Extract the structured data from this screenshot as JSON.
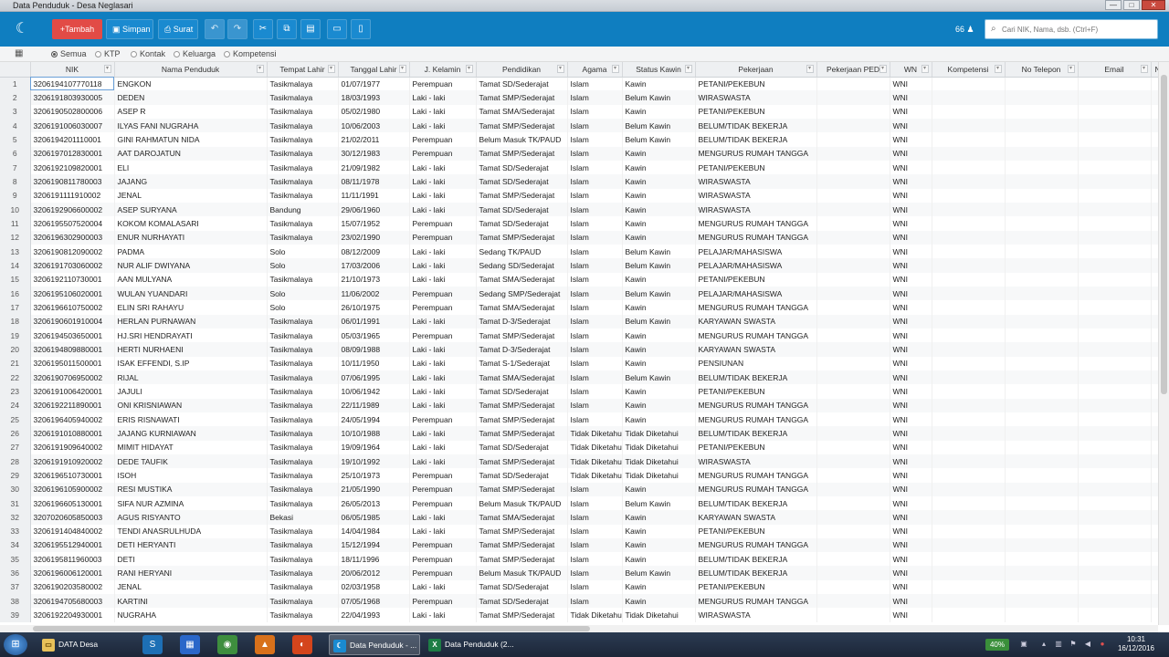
{
  "window": {
    "title": "Data Penduduk - Desa Neglasari",
    "min": "—",
    "max": "□",
    "close": "✕"
  },
  "toolbar": {
    "logo": "☾",
    "add_label": "+Tambah",
    "save_label": "Simpan",
    "letter_label": "Surat",
    "count": "66",
    "search_placeholder": "Cari NIK, Nama, dsb. (Ctrl+F)"
  },
  "filters": [
    "Semua",
    "KTP",
    "Kontak",
    "Keluarga",
    "Kompetensi"
  ],
  "table": {
    "columns": [
      "NIK",
      "Nama Penduduk",
      "Tempat Lahir",
      "Tanggal Lahir",
      "J. Kelamin",
      "Pendidikan",
      "Agama",
      "Status Kawin",
      "Pekerjaan",
      "Pekerjaan PED",
      "WN",
      "Kompetensi",
      "No Telepon",
      "Email",
      "No K"
    ],
    "rows": [
      [
        "3206194107770118",
        "ENGKON",
        "Tasikmalaya",
        "01/07/1977",
        "Perempuan",
        "Tamat SD/Sederajat",
        "Islam",
        "Kawin",
        "PETANI/PEKEBUN",
        "",
        "WNI"
      ],
      [
        "3206191803930005",
        "DEDEN",
        "Tasikmalaya",
        "18/03/1993",
        "Laki - laki",
        "Tamat SMP/Sederajat",
        "Islam",
        "Belum Kawin",
        "WIRASWASTA",
        "",
        "WNI"
      ],
      [
        "3206190502800006",
        "ASEP R",
        "Tasikmalaya",
        "05/02/1980",
        "Laki - laki",
        "Tamat SMA/Sederajat",
        "Islam",
        "Kawin",
        "PETANI/PEKEBUN",
        "",
        "WNI"
      ],
      [
        "3206191006030007",
        "ILYAS FANI NUGRAHA",
        "Tasikmalaya",
        "10/06/2003",
        "Laki - laki",
        "Tamat SMP/Sederajat",
        "Islam",
        "Belum Kawin",
        "BELUM/TIDAK BEKERJA",
        "",
        "WNI"
      ],
      [
        "3206194201110001",
        "GINI RAHMATUN NIDA",
        "Tasikmalaya",
        "21/02/2011",
        "Perempuan",
        "Belum Masuk TK/PAUD",
        "Islam",
        "Belum Kawin",
        "BELUM/TIDAK BEKERJA",
        "",
        "WNI"
      ],
      [
        "3206197012830001",
        "AAT DAROJATUN",
        "Tasikmalaya",
        "30/12/1983",
        "Perempuan",
        "Tamat SMP/Sederajat",
        "Islam",
        "Kawin",
        "MENGURUS RUMAH TANGGA",
        "",
        "WNI"
      ],
      [
        "3206192109820001",
        "ELI",
        "Tasikmalaya",
        "21/09/1982",
        "Laki - laki",
        "Tamat SD/Sederajat",
        "Islam",
        "Kawin",
        "PETANI/PEKEBUN",
        "",
        "WNI"
      ],
      [
        "3206190811780003",
        "JAJANG",
        "Tasikmalaya",
        "08/11/1978",
        "Laki - laki",
        "Tamat SD/Sederajat",
        "Islam",
        "Kawin",
        "WIRASWASTA",
        "",
        "WNI"
      ],
      [
        "3206191111910002",
        "JENAL",
        "Tasikmalaya",
        "11/11/1991",
        "Laki - laki",
        "Tamat SMP/Sederajat",
        "Islam",
        "Kawin",
        "WIRASWASTA",
        "",
        "WNI"
      ],
      [
        "3206192906600002",
        "ASEP SURYANA",
        "Bandung",
        "29/06/1960",
        "Laki - laki",
        "Tamat SD/Sederajat",
        "Islam",
        "Kawin",
        "WIRASWASTA",
        "",
        "WNI"
      ],
      [
        "3206195507520004",
        "KOKOM KOMALASARI",
        "Tasikmalaya",
        "15/07/1952",
        "Perempuan",
        "Tamat SD/Sederajat",
        "Islam",
        "Kawin",
        "MENGURUS RUMAH TANGGA",
        "",
        "WNI"
      ],
      [
        "3206196302900003",
        "ENUR NURHAYATI",
        "Tasikmalaya",
        "23/02/1990",
        "Perempuan",
        "Tamat SMP/Sederajat",
        "Islam",
        "Kawin",
        "MENGURUS RUMAH TANGGA",
        "",
        "WNI"
      ],
      [
        "3206190812090002",
        "PADMA",
        "Solo",
        "08/12/2009",
        "Laki - laki",
        "Sedang TK/PAUD",
        "Islam",
        "Belum Kawin",
        "PELAJAR/MAHASISWA",
        "",
        "WNI"
      ],
      [
        "3206191703060002",
        "NUR ALIF DWIYANA",
        "Solo",
        "17/03/2006",
        "Laki - laki",
        "Sedang SD/Sederajat",
        "Islam",
        "Belum Kawin",
        "PELAJAR/MAHASISWA",
        "",
        "WNI"
      ],
      [
        "3206192110730001",
        "AAN MULYANA",
        "Tasikmalaya",
        "21/10/1973",
        "Laki - laki",
        "Tamat SMA/Sederajat",
        "Islam",
        "Kawin",
        "PETANI/PEKEBUN",
        "",
        "WNI"
      ],
      [
        "3206195106020001",
        "WULAN YUANDARI",
        "Solo",
        "11/06/2002",
        "Perempuan",
        "Sedang SMP/Sederajat",
        "Islam",
        "Belum Kawin",
        "PELAJAR/MAHASISWA",
        "",
        "WNI"
      ],
      [
        "3206196610750002",
        "ELIN SRI RAHAYU",
        "Solo",
        "26/10/1975",
        "Perempuan",
        "Tamat SMA/Sederajat",
        "Islam",
        "Kawin",
        "MENGURUS RUMAH TANGGA",
        "",
        "WNI"
      ],
      [
        "3206190601910004",
        "HERLAN PURNAWAN",
        "Tasikmalaya",
        "06/01/1991",
        "Laki - laki",
        "Tamat D-3/Sederajat",
        "Islam",
        "Belum Kawin",
        "KARYAWAN SWASTA",
        "",
        "WNI"
      ],
      [
        "3206194503650001",
        "HJ.SRI HENDRAYATI",
        "Tasikmalaya",
        "05/03/1965",
        "Perempuan",
        "Tamat SMP/Sederajat",
        "Islam",
        "Kawin",
        "MENGURUS RUMAH TANGGA",
        "",
        "WNI"
      ],
      [
        "3206194809880001",
        "HERTI NURHAENI",
        "Tasikmalaya",
        "08/09/1988",
        "Laki - laki",
        "Tamat D-3/Sederajat",
        "Islam",
        "Kawin",
        "KARYAWAN SWASTA",
        "",
        "WNI"
      ],
      [
        "3206195011500001",
        "ISAK EFFENDI, S.IP",
        "Tasikmalaya",
        "10/11/1950",
        "Laki - laki",
        "Tamat S-1/Sederajat",
        "Islam",
        "Kawin",
        "PENSIUNAN",
        "",
        "WNI"
      ],
      [
        "3206190706950002",
        "RIJAL",
        "Tasikmalaya",
        "07/06/1995",
        "Laki - laki",
        "Tamat SMA/Sederajat",
        "Islam",
        "Belum Kawin",
        "BELUM/TIDAK BEKERJA",
        "",
        "WNI"
      ],
      [
        "3206191006420001",
        "JAJULI",
        "Tasikmalaya",
        "10/06/1942",
        "Laki - laki",
        "Tamat SD/Sederajat",
        "Islam",
        "Kawin",
        "PETANI/PEKEBUN",
        "",
        "WNI"
      ],
      [
        "3206192211890001",
        "ONI KRISNIAWAN",
        "Tasikmalaya",
        "22/11/1989",
        "Laki - laki",
        "Tamat SMP/Sederajat",
        "Islam",
        "Kawin",
        "MENGURUS RUMAH TANGGA",
        "",
        "WNI"
      ],
      [
        "3206196405940002",
        "ERIS RISNAWATI",
        "Tasikmalaya",
        "24/05/1994",
        "Perempuan",
        "Tamat SMP/Sederajat",
        "Islam",
        "Kawin",
        "MENGURUS RUMAH TANGGA",
        "",
        "WNI"
      ],
      [
        "3206191010880001",
        "JAJANG KURNIAWAN",
        "Tasikmalaya",
        "10/10/1988",
        "Laki - laki",
        "Tamat SMP/Sederajat",
        "Tidak Diketahui",
        "Tidak Diketahui",
        "BELUM/TIDAK BEKERJA",
        "",
        "WNI"
      ],
      [
        "3206191909640002",
        "MIMIT HIDAYAT",
        "Tasikmalaya",
        "19/09/1964",
        "Laki - laki",
        "Tamat SD/Sederajat",
        "Tidak Diketahui",
        "Tidak Diketahui",
        "PETANI/PEKEBUN",
        "",
        "WNI"
      ],
      [
        "3206191910920002",
        "DEDE TAUFIK",
        "Tasikmalaya",
        "19/10/1992",
        "Laki - laki",
        "Tamat SMP/Sederajat",
        "Tidak Diketahui",
        "Tidak Diketahui",
        "WIRASWASTA",
        "",
        "WNI"
      ],
      [
        "3206196510730001",
        "ISOH",
        "Tasikmalaya",
        "25/10/1973",
        "Perempuan",
        "Tamat SD/Sederajat",
        "Tidak Diketahui",
        "Tidak Diketahui",
        "MENGURUS RUMAH TANGGA",
        "",
        "WNI"
      ],
      [
        "3206196105900002",
        "RESI MUSTIKA",
        "Tasikmalaya",
        "21/05/1990",
        "Perempuan",
        "Tamat SMP/Sederajat",
        "Islam",
        "Kawin",
        "MENGURUS RUMAH TANGGA",
        "",
        "WNI"
      ],
      [
        "3206196605130001",
        "SIFA NUR AZMINA",
        "Tasikmalaya",
        "26/05/2013",
        "Perempuan",
        "Belum Masuk TK/PAUD",
        "Islam",
        "Belum Kawin",
        "BELUM/TIDAK BEKERJA",
        "",
        "WNI"
      ],
      [
        "3207020605850003",
        "AGUS RISYANTO",
        "Bekasi",
        "06/05/1985",
        "Laki - laki",
        "Tamat SMA/Sederajat",
        "Islam",
        "Kawin",
        "KARYAWAN SWASTA",
        "",
        "WNI"
      ],
      [
        "3206191404840002",
        "TENDI ANASRULHUDA",
        "Tasikmalaya",
        "14/04/1984",
        "Laki - laki",
        "Tamat SMP/Sederajat",
        "Islam",
        "Kawin",
        "PETANI/PEKEBUN",
        "",
        "WNI"
      ],
      [
        "3206195512940001",
        "DETI HERYANTI",
        "Tasikmalaya",
        "15/12/1994",
        "Perempuan",
        "Tamat SMP/Sederajat",
        "Islam",
        "Kawin",
        "MENGURUS RUMAH TANGGA",
        "",
        "WNI"
      ],
      [
        "3206195811960003",
        "DETI",
        "Tasikmalaya",
        "18/11/1996",
        "Perempuan",
        "Tamat SMP/Sederajat",
        "Islam",
        "Kawin",
        "BELUM/TIDAK BEKERJA",
        "",
        "WNI"
      ],
      [
        "3206196006120001",
        "RANI HERYANI",
        "Tasikmalaya",
        "20/06/2012",
        "Perempuan",
        "Belum Masuk TK/PAUD",
        "Islam",
        "Belum Kawin",
        "BELUM/TIDAK BEKERJA",
        "",
        "WNI"
      ],
      [
        "3206190203580002",
        "JENAL",
        "Tasikmalaya",
        "02/03/1958",
        "Laki - laki",
        "Tamat SD/Sederajat",
        "Islam",
        "Kawin",
        "PETANI/PEKEBUN",
        "",
        "WNI"
      ],
      [
        "3206194705680003",
        "KARTINI",
        "Tasikmalaya",
        "07/05/1968",
        "Perempuan",
        "Tamat SD/Sederajat",
        "Islam",
        "Kawin",
        "MENGURUS RUMAH TANGGA",
        "",
        "WNI"
      ],
      [
        "3206192204930001",
        "NUGRAHA",
        "Tasikmalaya",
        "22/04/1993",
        "Laki - laki",
        "Tamat SMP/Sederajat",
        "Tidak Diketahui",
        "Tidak Diketahui",
        "WIRASWASTA",
        "",
        "WNI"
      ]
    ]
  },
  "taskbar": {
    "tasks": [
      "DATA Desa",
      "Data Penduduk - ...",
      "Data Penduduk (2..."
    ],
    "battery": "40%",
    "time": "10:31",
    "date": "16/12/2016"
  },
  "colors": {
    "toolbar": "#0f7ec0",
    "add_button": "#e24b46"
  }
}
